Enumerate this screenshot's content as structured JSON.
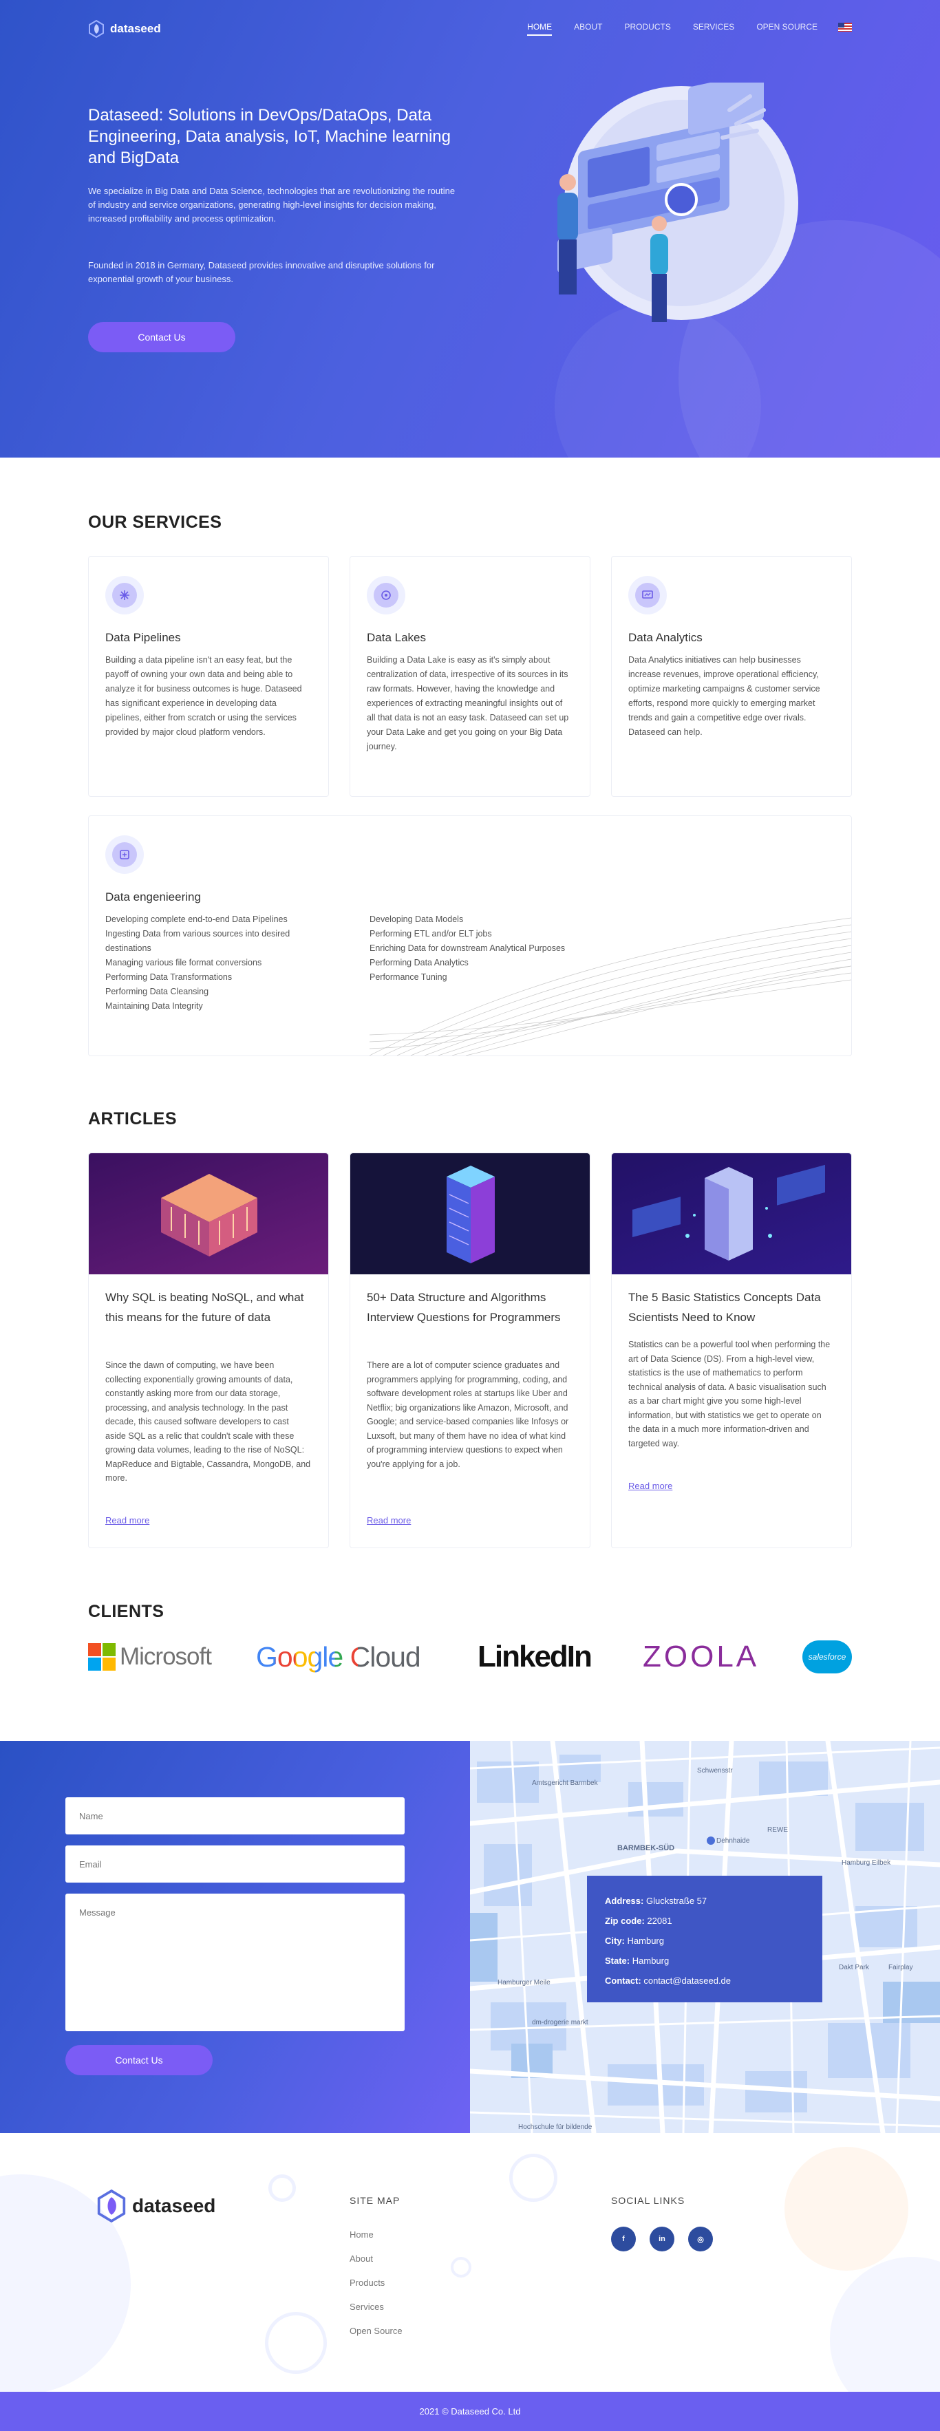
{
  "brand": {
    "name": "dataseed"
  },
  "nav": {
    "items": [
      "HOME",
      "ABOUT",
      "PRODUCTS",
      "SERVICES",
      "OPEN SOURCE"
    ],
    "active": "HOME",
    "language_icon": "us-flag-icon"
  },
  "hero": {
    "title": "Dataseed: Solutions in DevOps/DataOps, Data Engineering, Data analysis, IoT, Machine learning and BigData",
    "p1": "We specialize in Big Data and Data Science, technologies that are revolutionizing the routine of industry and service organizations, generating high-level insights for decision making, increased profitability and process optimization.",
    "p2": "Founded in 2018 in Germany, Dataseed provides innovative and disruptive solutions for exponential growth of your business.",
    "cta": "Contact Us"
  },
  "services": {
    "title": "OUR SERVICES",
    "items": [
      {
        "title": "Data Pipelines",
        "body": "Building a data pipeline isn't an easy feat, but the payoff of owning your own data and being able to analyze it for business outcomes is huge. Dataseed has significant experience in developing data pipelines, either from scratch or using the services provided by major cloud platform vendors.",
        "icon": "pipeline-icon"
      },
      {
        "title": "Data Lakes",
        "body": "Building a Data Lake is easy as it's simply about centralization of data, irrespective of its sources in its raw formats. However, having the knowledge and experiences of extracting meaningful insights out of all that data is not an easy task. Dataseed can set up your Data Lake and get you going on your Big Data journey.",
        "icon": "data-lake-icon"
      },
      {
        "title": "Data Analytics",
        "body": "Data Analytics initiatives can help businesses increase revenues, improve operational efficiency, optimize marketing campaigns & customer service efforts, respond more quickly to emerging market trends and gain a competitive edge over rivals. Dataseed can help.",
        "icon": "analytics-icon"
      }
    ],
    "engineering": {
      "title": "Data engenieering",
      "col1": [
        "Developing complete end-to-end Data Pipelines",
        "Ingesting Data from various sources into desired destinations",
        "Managing various file format conversions",
        "Performing Data Transformations",
        "Performing Data Cleansing",
        "Maintaining Data Integrity"
      ],
      "col2": [
        "Developing Data Models",
        "Performing ETL and/or ELT jobs",
        "Enriching Data for downstream Analytical Purposes",
        "Performing Data Analytics",
        "Performance Tuning"
      ]
    }
  },
  "articles": {
    "title": "ARTICLES",
    "read_more": "Read more",
    "items": [
      {
        "title": "Why SQL is beating NoSQL, and what this means for the future of data",
        "body": "Since the dawn of computing, we have been collecting exponentially growing amounts of data, constantly asking more from our data storage, processing, and analysis technology. In the past decade, this caused software developers to cast aside SQL as a relic that couldn't scale with these growing data volumes, leading to the rise of NoSQL: MapReduce and Bigtable, Cassandra, MongoDB, and more."
      },
      {
        "title": "50+ Data Structure and Algorithms Interview Questions for Programmers",
        "body": "There are a lot of computer science graduates and programmers applying for programming, coding, and software development roles at startups like Uber and Netflix; big organizations like Amazon, Microsoft, and Google; and service-based companies like Infosys or Luxsoft, but many of them have no idea of what kind of programming interview questions to expect when you're applying for a job."
      },
      {
        "title": "The 5 Basic Statistics Concepts Data Scientists Need to Know",
        "body": "Statistics can be a powerful tool when performing the art of Data Science (DS). From a high-level view, statistics is the use of mathematics to perform technical analysis of data. A basic visualisation such as a bar chart might give you some high-level information, but with statistics we get to operate on the data in a much more information-driven and targeted way."
      }
    ]
  },
  "clients": {
    "title": "CLIENTS",
    "items": [
      "Microsoft",
      "Google Cloud",
      "LinkedIn",
      "ZOOLA",
      "salesforce"
    ]
  },
  "contact": {
    "name_placeholder": "Name",
    "email_placeholder": "Email",
    "message_placeholder": "Message",
    "send": "Contact Us",
    "address_label": "Address:",
    "address": "Gluckstraße 57",
    "zip_label": "Zip code:",
    "zip": "22081",
    "city_label": "City:",
    "city": "Hamburg",
    "state_label": "State:",
    "state": "Hamburg",
    "contact_label": "Contact:",
    "email": "contact@dataseed.de",
    "map_labels": [
      "BARMBEK-SÜD",
      "Dehnhaide",
      "Schwensstr",
      "REWE",
      "Amtsgericht Barmbek",
      "Hamburger Meile",
      "Hamburg Eilbek",
      "dm-drogerie markt",
      "Hochschule für bildende",
      "Fairplay",
      "Dakt Park"
    ]
  },
  "footer": {
    "sitemap_title": "SITE MAP",
    "links": [
      "Home",
      "About",
      "Products",
      "Services",
      "Open Source"
    ],
    "social_title": "SOCIAL LINKS",
    "social": [
      {
        "label": "f",
        "icon": "facebook-icon"
      },
      {
        "label": "in",
        "icon": "linkedin-icon"
      },
      {
        "label": "◎",
        "icon": "instagram-icon"
      }
    ],
    "copyright": "2021 © Dataseed Co. Ltd"
  }
}
